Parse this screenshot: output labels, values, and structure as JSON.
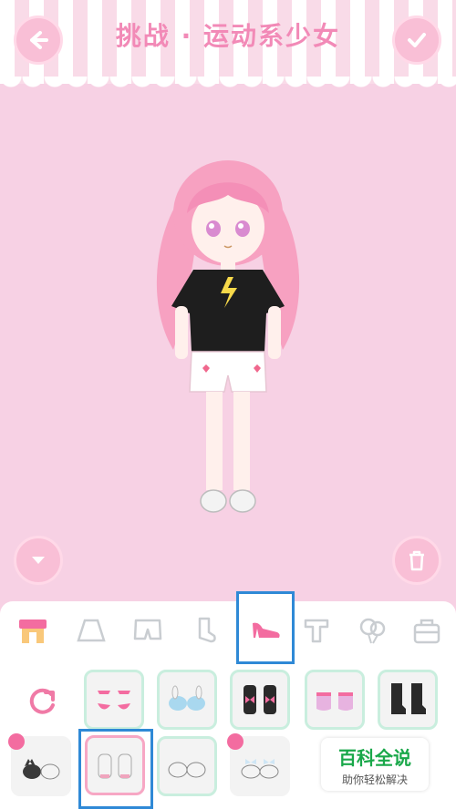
{
  "header": {
    "title": "挑战 · 运动系少女"
  },
  "icons": {
    "back": "back-arrow-icon",
    "confirm": "checkmark-icon",
    "down": "chevron-down-icon",
    "trash": "trash-icon",
    "reset": "reset-icon"
  },
  "tabs": [
    {
      "name": "store-tab",
      "icon": "shop-icon"
    },
    {
      "name": "skirt-tab",
      "icon": "skirt-icon"
    },
    {
      "name": "shorts-tab",
      "icon": "shorts-icon"
    },
    {
      "name": "socks-tab",
      "icon": "sock-icon"
    },
    {
      "name": "shoes-tab",
      "icon": "high-heel-icon",
      "selected": true
    },
    {
      "name": "shirt-tab",
      "icon": "t-shirt-icon"
    },
    {
      "name": "balloon-tab",
      "icon": "balloon-icon"
    },
    {
      "name": "bag-tab",
      "icon": "bag-icon"
    }
  ],
  "watermark": {
    "title": "百科全说",
    "subtitle": "助你轻松解决"
  },
  "colors": {
    "accent": "#f28ab7",
    "selected_border": "#2f89d6",
    "item_border": "#c9eede"
  }
}
